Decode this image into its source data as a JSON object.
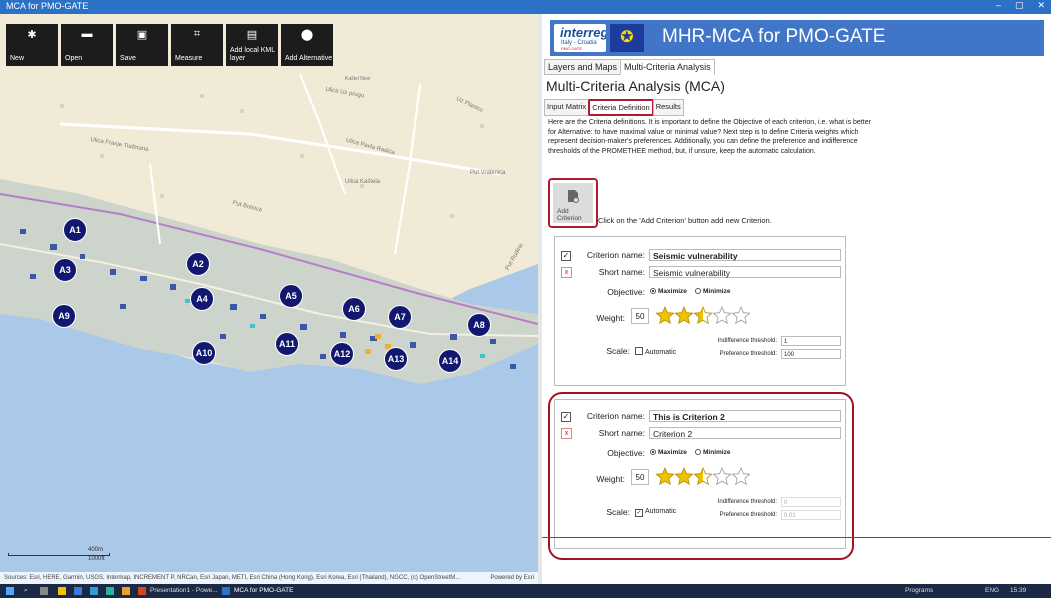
{
  "window": {
    "title": "MCA for PMO-GATE",
    "min": "–",
    "restore": "▢",
    "close": "✕"
  },
  "toolbar": {
    "buttons": [
      {
        "label": "New",
        "icon": "new-icon",
        "glyph": "✱"
      },
      {
        "label": "Open",
        "icon": "folder-icon",
        "glyph": "▬"
      },
      {
        "label": "Save",
        "icon": "save-icon",
        "glyph": "▣"
      },
      {
        "label": "Measure",
        "icon": "crop-icon",
        "glyph": "⌗"
      },
      {
        "label": "Add local KML layer",
        "icon": "document-add-icon",
        "glyph": "▤"
      },
      {
        "label": "Add Alternative",
        "icon": "map-pin-icon",
        "glyph": "⬤"
      }
    ]
  },
  "map": {
    "street_labels": [
      "Ulica Uz prugu",
      "Uz Planicu",
      "Ulica Franje Tudmana",
      "Kaštel Novi",
      "Ulica Pavla Radića",
      "Put Vrabinica",
      "Put Bolnice",
      "Ulica Kaštela",
      "Put Rudine"
    ],
    "markers": [
      "A1",
      "A2",
      "A3",
      "A4",
      "A5",
      "A6",
      "A7",
      "A8",
      "A9",
      "A10",
      "A11",
      "A12",
      "A13",
      "A14"
    ],
    "scale_top": "400m",
    "scale_bottom": "1000ft",
    "attribution": "Sources: Esri, HERE, Garmin, USGS, Intermap, INCREMENT P, NRCan, Esri Japan, METI, Esri China (Hong Kong), Esri Korea, Esri (Thailand), NGCC, (c) OpenStreetM...",
    "powered": "Powered by Esri"
  },
  "banner": {
    "logo_main": "interreg",
    "logo_sub": "Italy - Croatia",
    "logo_tag": "PMO-GATE",
    "title": "MHR-MCA for PMO-GATE"
  },
  "tabs": [
    "Layers and Maps",
    "Multi-Criteria Analysis"
  ],
  "mca": {
    "title": "Multi-Criteria Analysis (MCA)",
    "subtabs": [
      "Input Matrix",
      "Criteria Definition",
      "Results"
    ],
    "description": "Here are the Criteria definitions. It is important to define the Objective of each criterion, i.e. what is better for Alternative: to have maximal value or minimal value? Next step is to define Criteria weights which represent decision-maker's preferences. Additionally, you can define the preference and indifference thresholds of the PROMETHEE method, but, if unsure, keep the automatic calculation.",
    "add_button": "Add Criterion",
    "add_hint": "Click on the 'Add Criterion' button add new Criterion.",
    "labels": {
      "criterion_name": "Criterion name:",
      "short_name": "Short name:",
      "objective": "Objective:",
      "maximize": "Maximize",
      "minimize": "Minimize",
      "weight": "Weight:",
      "scale": "Scale:",
      "automatic": "Automatic",
      "indifference": "Indifference threshold:",
      "preference": "Preference threshold:"
    },
    "criteria": [
      {
        "name": "Seismic vulnerability",
        "short": "Seismic vulnerability",
        "objective": "Maximize",
        "weight": "50",
        "stars": 2.5,
        "automatic": false,
        "indifference": "1",
        "preference": "100"
      },
      {
        "name": "This is Criterion 2",
        "short": "Criterion 2",
        "objective": "Maximize",
        "weight": "50",
        "stars": 2.5,
        "automatic": true,
        "indifference": "0",
        "preference": "0.01"
      }
    ]
  },
  "taskbar": {
    "items": [
      "Presentation1 - Powe...",
      "MCA for PMO-GATE"
    ],
    "tray": "Programs",
    "lang": "ENG",
    "time": "15:39"
  },
  "colors": {
    "titlebar": "#2b72c6",
    "banner": "#4175c8",
    "marker": "#121770",
    "highlight": "#b3192e",
    "star": "#f2c200"
  }
}
